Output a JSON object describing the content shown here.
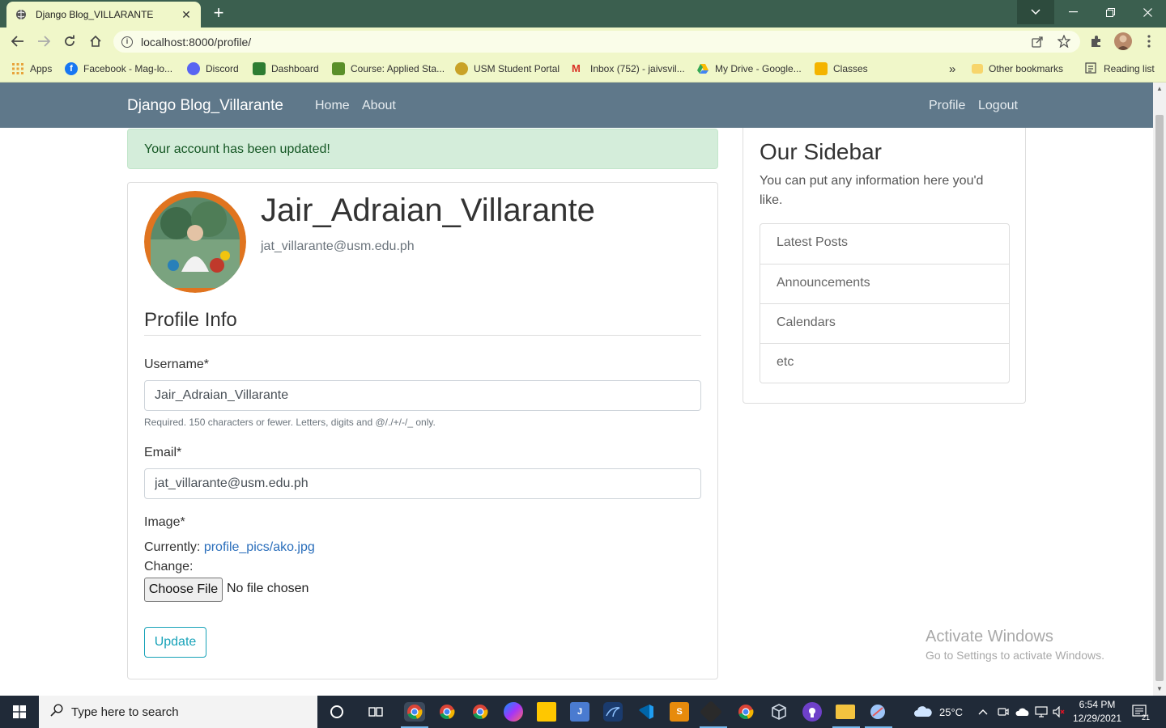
{
  "browser": {
    "tab_title": "Django Blog_VILLARANTE",
    "new_tab": "+",
    "url": "localhost:8000/profile/",
    "bookmarks": [
      {
        "label": "Apps",
        "icon": "apps-grid-icon",
        "color": "#e8a33b"
      },
      {
        "label": "Facebook - Mag-lo...",
        "icon": "facebook-icon",
        "color": "#1877f2"
      },
      {
        "label": "Discord",
        "icon": "discord-icon",
        "color": "#5865f2"
      },
      {
        "label": "Dashboard",
        "icon": "usm-icon",
        "color": "#2e7d32"
      },
      {
        "label": "Course: Applied Sta...",
        "icon": "course-icon",
        "color": "#5a8f29"
      },
      {
        "label": "USM Student Portal",
        "icon": "usm-portal-icon",
        "color": "#c9a227"
      },
      {
        "label": "Inbox (752) - jaivsvil...",
        "icon": "gmail-icon",
        "color": "#d93025"
      },
      {
        "label": "My Drive - Google...",
        "icon": "drive-icon",
        "color": "#34a853"
      },
      {
        "label": "Classes",
        "icon": "classroom-icon",
        "color": "#f4b400"
      }
    ],
    "bookmarks_more": "»",
    "other_bookmarks": "Other bookmarks",
    "reading_list": "Reading list"
  },
  "site": {
    "brand": "Django Blog_Villarante",
    "nav_left": [
      "Home",
      "About"
    ],
    "nav_right": [
      "Profile",
      "Logout"
    ]
  },
  "alert": "Your account has been updated!",
  "profile": {
    "username": "Jair_Adraian_Villarante",
    "email": "jat_villarante@usm.edu.ph"
  },
  "form": {
    "legend": "Profile Info",
    "username_label": "Username*",
    "username_value": "Jair_Adraian_Villarante",
    "username_help": "Required. 150 characters or fewer. Letters, digits and @/./+/-/_ only.",
    "email_label": "Email*",
    "email_value": "jat_villarante@usm.edu.ph",
    "image_label": "Image*",
    "currently_label": "Currently:",
    "current_file": "profile_pics/ako.jpg",
    "change_label": "Change:",
    "choose_file": "Choose File",
    "no_file": "No file chosen",
    "submit": "Update"
  },
  "sidebar": {
    "title": "Our Sidebar",
    "text": "You can put any information here you'd like.",
    "items": [
      "Latest Posts",
      "Announcements",
      "Calendars",
      "etc"
    ]
  },
  "watermark": {
    "line1": "Activate Windows",
    "line2": "Go to Settings to activate Windows."
  },
  "taskbar": {
    "search_placeholder": "Type here to search",
    "temperature": "25°C",
    "time": "6:54 PM",
    "date": "12/29/2021",
    "notification_count": "21"
  },
  "colors": {
    "tab_bar": "#3b5f4f",
    "toolbar": "#f0f7c9",
    "site_nav": "#5f788a",
    "alert_bg": "#d4edda",
    "alert_text": "#155724",
    "accent_info": "#17a2b8",
    "link": "#2a6ebb"
  }
}
